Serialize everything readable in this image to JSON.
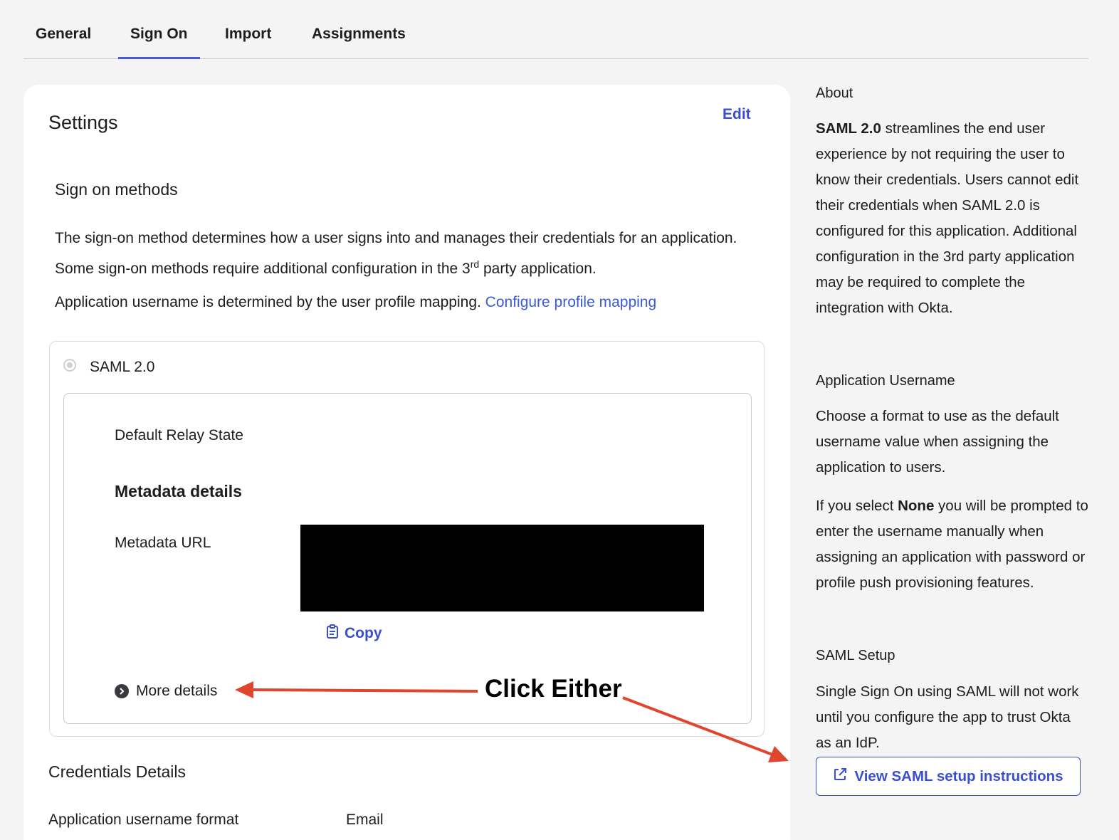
{
  "tabs": [
    {
      "label": "General"
    },
    {
      "label": "Sign On"
    },
    {
      "label": "Import"
    },
    {
      "label": "Assignments"
    }
  ],
  "settings": {
    "title": "Settings",
    "edit_label": "Edit",
    "sign_on_title": "Sign on methods",
    "description_part1": "The sign-on method determines how a user signs into and manages their credentials for an application. Some sign-on methods require additional configuration in the 3",
    "description_sup": "rd",
    "description_part2": " party application.",
    "username_text": "Application username is determined by the user profile mapping.",
    "configure_link": "Configure profile mapping",
    "method_label": "SAML 2.0",
    "relay_state_label": "Default Relay State",
    "metadata_title": "Metadata details",
    "metadata_url_label": "Metadata URL",
    "copy_label": "Copy",
    "more_details_label": "More details",
    "credentials_title": "Credentials Details",
    "username_format_label": "Application username format",
    "username_format_value": "Email"
  },
  "sidebar": {
    "about_title": "About",
    "about_bold": "SAML 2.0",
    "about_text": " streamlines the end user experience by not requiring the user to know their credentials. Users cannot edit their credentials when SAML 2.0 is configured for this application. Additional configuration in the 3rd party application may be required to complete the integration with Okta.",
    "app_username_title": "Application Username",
    "app_username_text": "Choose a format to use as the default username value when assigning the application to users.",
    "none_text_pre": "If you select ",
    "none_bold": "None",
    "none_text_post": " you will be prompted to enter the username manually when assigning an application with password or profile push provisioning features.",
    "saml_setup_title": "SAML Setup",
    "saml_setup_text": "Single Sign On using SAML will not work until you configure the app to trust Okta as an IdP.",
    "saml_button_label": "View SAML setup instructions"
  },
  "annotation": {
    "text": "Click Either",
    "color": "#e0452e"
  }
}
